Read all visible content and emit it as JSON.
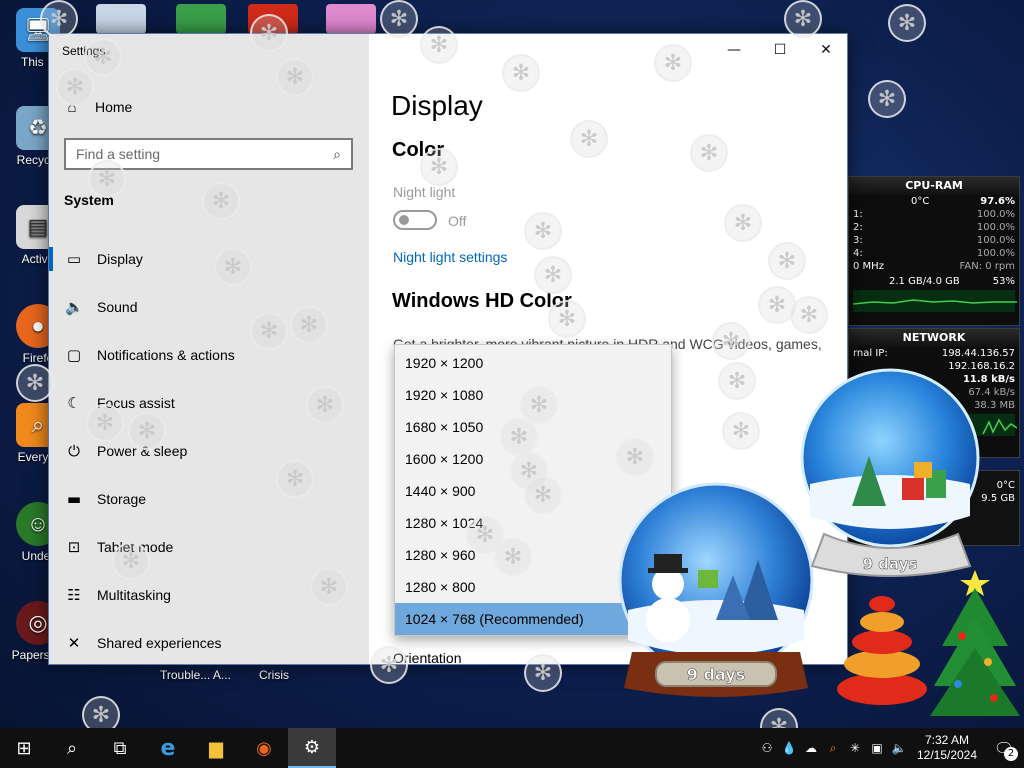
{
  "desktop": {
    "icons": [
      {
        "label": "This P",
        "color": "#3a8fd8"
      },
      {
        "label": "Recycle",
        "color": "#7aa7c7"
      },
      {
        "label": "Activa",
        "color": "#d8d8d8"
      },
      {
        "label": "Firefo",
        "color": "#e8661d"
      },
      {
        "label": "Everyth",
        "color": "#f08a1c"
      },
      {
        "label": "Under",
        "color": "#2a7a2a"
      },
      {
        "label": "Papers, P",
        "color": "#6a1a1a"
      }
    ],
    "bottom_labels": [
      "Trouble... A...",
      "Crisis"
    ]
  },
  "window": {
    "title": "Settings",
    "controls": {
      "minimize": "—",
      "maximize": "☐",
      "close": "✕"
    },
    "sidebar": {
      "home": "Home",
      "search_placeholder": "Find a setting",
      "section": "System",
      "items": [
        {
          "label": "Display",
          "icon": "display-icon",
          "glyph": "▭"
        },
        {
          "label": "Sound",
          "icon": "sound-icon",
          "glyph": "🔈"
        },
        {
          "label": "Notifications & actions",
          "icon": "notifications-icon",
          "glyph": "▢"
        },
        {
          "label": "Focus assist",
          "icon": "moon-icon",
          "glyph": "☾"
        },
        {
          "label": "Power & sleep",
          "icon": "power-icon",
          "glyph": "⏻"
        },
        {
          "label": "Storage",
          "icon": "storage-icon",
          "glyph": "▬"
        },
        {
          "label": "Tablet mode",
          "icon": "tablet-icon",
          "glyph": "⊡"
        },
        {
          "label": "Multitasking",
          "icon": "multitasking-icon",
          "glyph": "☷"
        },
        {
          "label": "Shared experiences",
          "icon": "shared-icon",
          "glyph": "✕"
        }
      ]
    },
    "content": {
      "page_title": "Display",
      "color_heading": "Color",
      "night_light_label": "Night light",
      "night_light_state": "Off",
      "night_light_link": "Night light settings",
      "hd_heading": "Windows HD Color",
      "hd_description": "Get a brighter, more vibrant picture in HDR and WCG videos, games,",
      "orientation_label": "Orientation",
      "resolution_options": [
        "1920 × 1200",
        "1920 × 1080",
        "1680 × 1050",
        "1600 × 1200",
        "1440 × 900",
        "1280 × 1024",
        "1280 × 960",
        "1280 × 800",
        "1024 × 768 (Recommended)"
      ],
      "selected_resolution": "1024 × 768 (Recommended)"
    }
  },
  "gadgets": {
    "cpu": {
      "title": "CPU-RAM",
      "temp": "0°C",
      "total": "97.6%",
      "cores": [
        {
          "label": "1:",
          "value": "100.0%"
        },
        {
          "label": "2:",
          "value": "100.0%"
        },
        {
          "label": "3:",
          "value": "100.0%"
        },
        {
          "label": "4:",
          "value": "100.0%"
        }
      ],
      "freq": "0 MHz",
      "fan": "FAN: 0 rpm",
      "ram": "2.1 GB/4.0 GB",
      "ram_pct": "53%",
      "ram_fraction": 0.53
    },
    "network": {
      "title": "NETWORK",
      "external_ip_label": "rnal IP:",
      "external_ip": "198.44.136.57",
      "internal_ip": "192.168.16.2",
      "up": "11.8 kB/s",
      "down": "67.4 kB/s",
      "total": "38.3 MB"
    },
    "extra": {
      "temp": "0°C",
      "size": "9.5 GB"
    }
  },
  "globes": {
    "countdown_1": "9 days",
    "countdown_2": "9 days"
  },
  "taskbar": {
    "buttons": [
      {
        "name": "start-button",
        "glyph": "⊞"
      },
      {
        "name": "search-button",
        "glyph": "⌕"
      },
      {
        "name": "task-view-button",
        "glyph": "⧉"
      },
      {
        "name": "ie-button",
        "glyph": "e"
      },
      {
        "name": "explorer-button",
        "glyph": "▆"
      },
      {
        "name": "firefox-button",
        "glyph": "◉"
      },
      {
        "name": "settings-button",
        "glyph": "⚙"
      }
    ],
    "time": "7:32 AM",
    "date": "12/15/2024",
    "notification_count": "2"
  },
  "colors": {
    "accent": "#0067c0",
    "selected_item": "#6fa8dc",
    "sidebar_bg": "#e6e6e6",
    "taskbar_bg": "#101010"
  }
}
